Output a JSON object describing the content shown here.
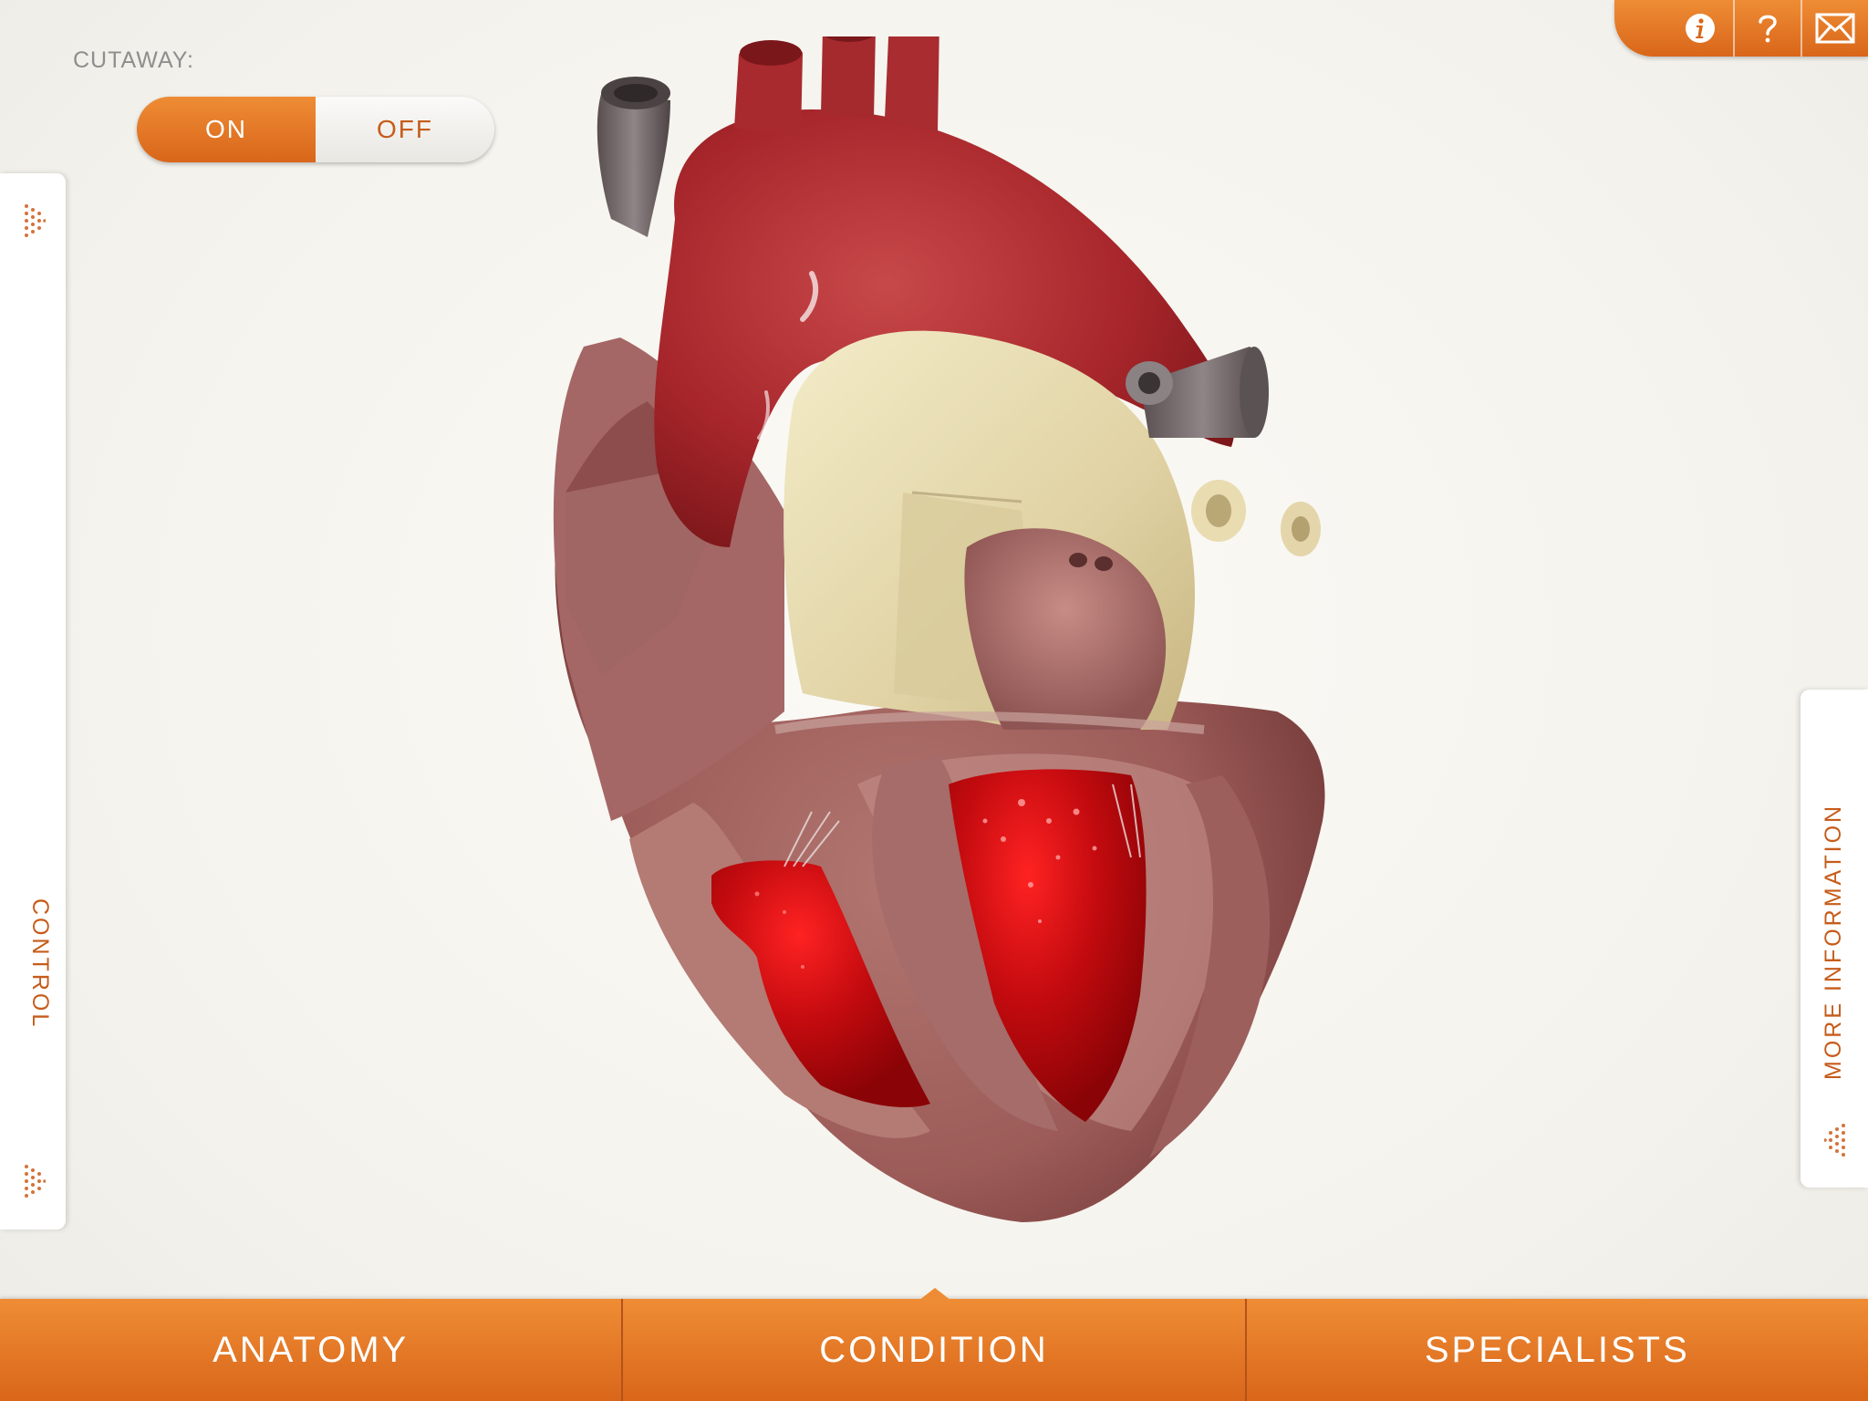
{
  "cutaway": {
    "label": "CUTAWAY:",
    "on_label": "ON",
    "off_label": "OFF",
    "selected": "ON"
  },
  "side_panels": {
    "control_label": "CONTROL",
    "more_info_label": "MORE INFORMATION"
  },
  "toolbar": {
    "info_icon": "info-icon",
    "help_icon": "help-icon",
    "email_icon": "email-icon"
  },
  "bottom_nav": {
    "tabs": [
      {
        "label": "ANATOMY"
      },
      {
        "label": "CONDITION"
      },
      {
        "label": "SPECIALISTS"
      }
    ],
    "active": "CONDITION"
  },
  "model": {
    "icon": "heart-3d-model"
  },
  "colors": {
    "accent": "#e57a27",
    "accent_dark": "#c65c1b",
    "background": "#f5f4ef"
  }
}
